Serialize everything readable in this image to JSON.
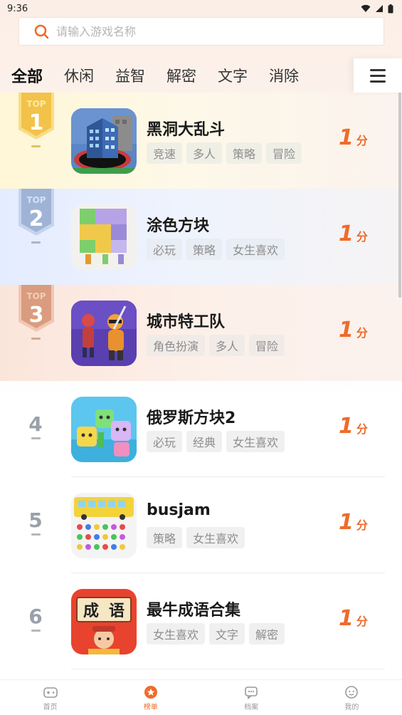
{
  "status_bar": {
    "time": "9:36"
  },
  "search": {
    "placeholder": "请输入游戏名称"
  },
  "tabs": [
    "全部",
    "休闲",
    "益智",
    "解密",
    "文字",
    "消除"
  ],
  "badge": {
    "label": "TOP"
  },
  "games": [
    {
      "rank": "1",
      "name": "黑洞大乱斗",
      "tags": [
        "竞速",
        "多人",
        "策略",
        "冒险"
      ],
      "score": "1",
      "unit": "分"
    },
    {
      "rank": "2",
      "name": "涂色方块",
      "tags": [
        "必玩",
        "策略",
        "女生喜欢"
      ],
      "score": "1",
      "unit": "分"
    },
    {
      "rank": "3",
      "name": "城市特工队",
      "tags": [
        "角色扮演",
        "多人",
        "冒险"
      ],
      "score": "1",
      "unit": "分"
    },
    {
      "rank": "4",
      "name": "俄罗斯方块2",
      "tags": [
        "必玩",
        "经典",
        "女生喜欢"
      ],
      "score": "1",
      "unit": "分"
    },
    {
      "rank": "5",
      "name": "busjam",
      "tags": [
        "策略",
        "女生喜欢"
      ],
      "score": "1",
      "unit": "分"
    },
    {
      "rank": "6",
      "name": "最牛成语合集",
      "tags": [
        "女生喜欢",
        "文字",
        "解密"
      ],
      "score": "1",
      "unit": "分"
    }
  ],
  "icon_art": {
    "idiom_char_1": "成",
    "idiom_char_2": "语"
  },
  "bottom_nav": [
    {
      "label": "首页",
      "icon": "gamepad-icon"
    },
    {
      "label": "榜单",
      "icon": "rank-star-icon"
    },
    {
      "label": "档案",
      "icon": "archive-chat-icon"
    },
    {
      "label": "我的",
      "icon": "profile-face-icon"
    }
  ],
  "colors": {
    "accent": "#ef6b2a",
    "gold": "#f3c24a",
    "silver": "#9fb3d6",
    "bronze": "#d99c7e"
  }
}
